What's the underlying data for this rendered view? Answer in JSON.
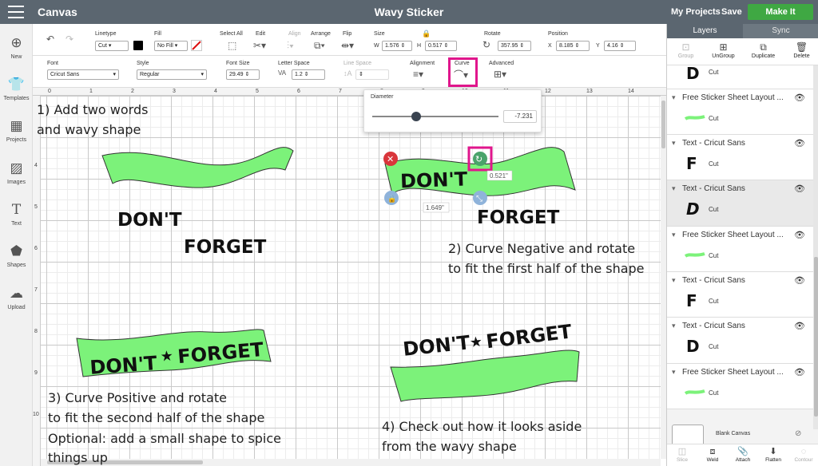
{
  "topbar": {
    "app_title": "Canvas",
    "doc_title": "Wavy Sticker",
    "my_projects": "My Projects",
    "save": "Save",
    "make_it": "Make It"
  },
  "sidebar": {
    "items": [
      {
        "label": "New",
        "icon": "plus-circle-icon"
      },
      {
        "label": "Templates",
        "icon": "shirt-icon"
      },
      {
        "label": "Projects",
        "icon": "projects-icon"
      },
      {
        "label": "Images",
        "icon": "image-icon"
      },
      {
        "label": "Text",
        "icon": "text-icon"
      },
      {
        "label": "Shapes",
        "icon": "shapes-icon"
      },
      {
        "label": "Upload",
        "icon": "upload-cloud-icon"
      }
    ]
  },
  "toolbar1": {
    "linetype_label": "Linetype",
    "linetype_value": "Cut",
    "fill_label": "Fill",
    "fill_value": "No Fill",
    "select_all_label": "Select All",
    "edit_label": "Edit",
    "align_label": "Align",
    "arrange_label": "Arrange",
    "flip_label": "Flip",
    "size_label": "Size",
    "size_w_prefix": "W",
    "size_w": "1.576",
    "size_h_prefix": "H",
    "size_h": "0.517",
    "rotate_label": "Rotate",
    "rotate_value": "357.95",
    "position_label": "Position",
    "pos_x_prefix": "X",
    "pos_x": "8.185",
    "pos_y_prefix": "Y",
    "pos_y": "4.16",
    "swatch_color": "#000000"
  },
  "toolbar2": {
    "font_label": "Font",
    "font_value": "Cricut Sans",
    "style_label": "Style",
    "style_value": "Regular",
    "font_size_label": "Font Size",
    "font_size_value": "29.49",
    "letter_space_label": "Letter Space",
    "letter_space_value": "1.2",
    "line_space_label": "Line Space",
    "alignment_label": "Alignment",
    "curve_label": "Curve",
    "advanced_label": "Advanced"
  },
  "popover": {
    "label": "Diameter",
    "value": "-7.231",
    "slider_fraction": 0.35
  },
  "ruler": {
    "top": [
      "0",
      "1",
      "2",
      "3",
      "4",
      "5",
      "6",
      "7",
      "8",
      "9",
      "10",
      "11",
      "12",
      "13",
      "14"
    ],
    "left": [
      "4",
      "5",
      "6",
      "7",
      "8",
      "9",
      "10"
    ]
  },
  "canvas": {
    "shape_color": "#7cf27a",
    "word_dont": "DON'T",
    "word_forget": "FORGET",
    "star": "★",
    "dim_height": "0.521\"",
    "dim_width": "1.649\"",
    "annotations": {
      "step1_line1": "1) Add two words",
      "step1_line2": "and wavy shape",
      "step2_line1": "2) Curve Negative and rotate",
      "step2_line2": "to fit the first half of the shape",
      "step3_line1": "3) Curve Positive and rotate",
      "step3_line2": "to fit the second half of the shape",
      "step3_line3": "Optional: add a small shape to spice",
      "step3_line4": "things up",
      "step4_line1": "4) Check out how it looks aside",
      "step4_line2": "from the wavy shape"
    }
  },
  "right_panel": {
    "tabs": [
      "Layers",
      "Sync"
    ],
    "tools": [
      "Group",
      "UnGroup",
      "Duplicate",
      "Delete"
    ],
    "layers": [
      {
        "title": "",
        "thumb": "D",
        "type": "Cut"
      },
      {
        "title": "Free Sticker Sheet Layout ...",
        "thumb": "",
        "type": "Cut"
      },
      {
        "title": "Text - Cricut Sans",
        "thumb": "F",
        "type": "Cut"
      },
      {
        "title": "Text - Cricut Sans",
        "thumb": "D",
        "type": "Cut"
      },
      {
        "title": "Free Sticker Sheet Layout ...",
        "thumb": "",
        "type": "Cut"
      },
      {
        "title": "Text - Cricut Sans",
        "thumb": "F",
        "type": "Cut"
      },
      {
        "title": "Text - Cricut Sans",
        "thumb": "D",
        "type": "Cut"
      },
      {
        "title": "Free Sticker Sheet Layout ...",
        "thumb": "",
        "type": "Cut"
      }
    ],
    "blank_canvas": "Blank Canvas",
    "bottom_tools": [
      "Slice",
      "Weld",
      "Attach",
      "Flatten",
      "Contour"
    ]
  }
}
